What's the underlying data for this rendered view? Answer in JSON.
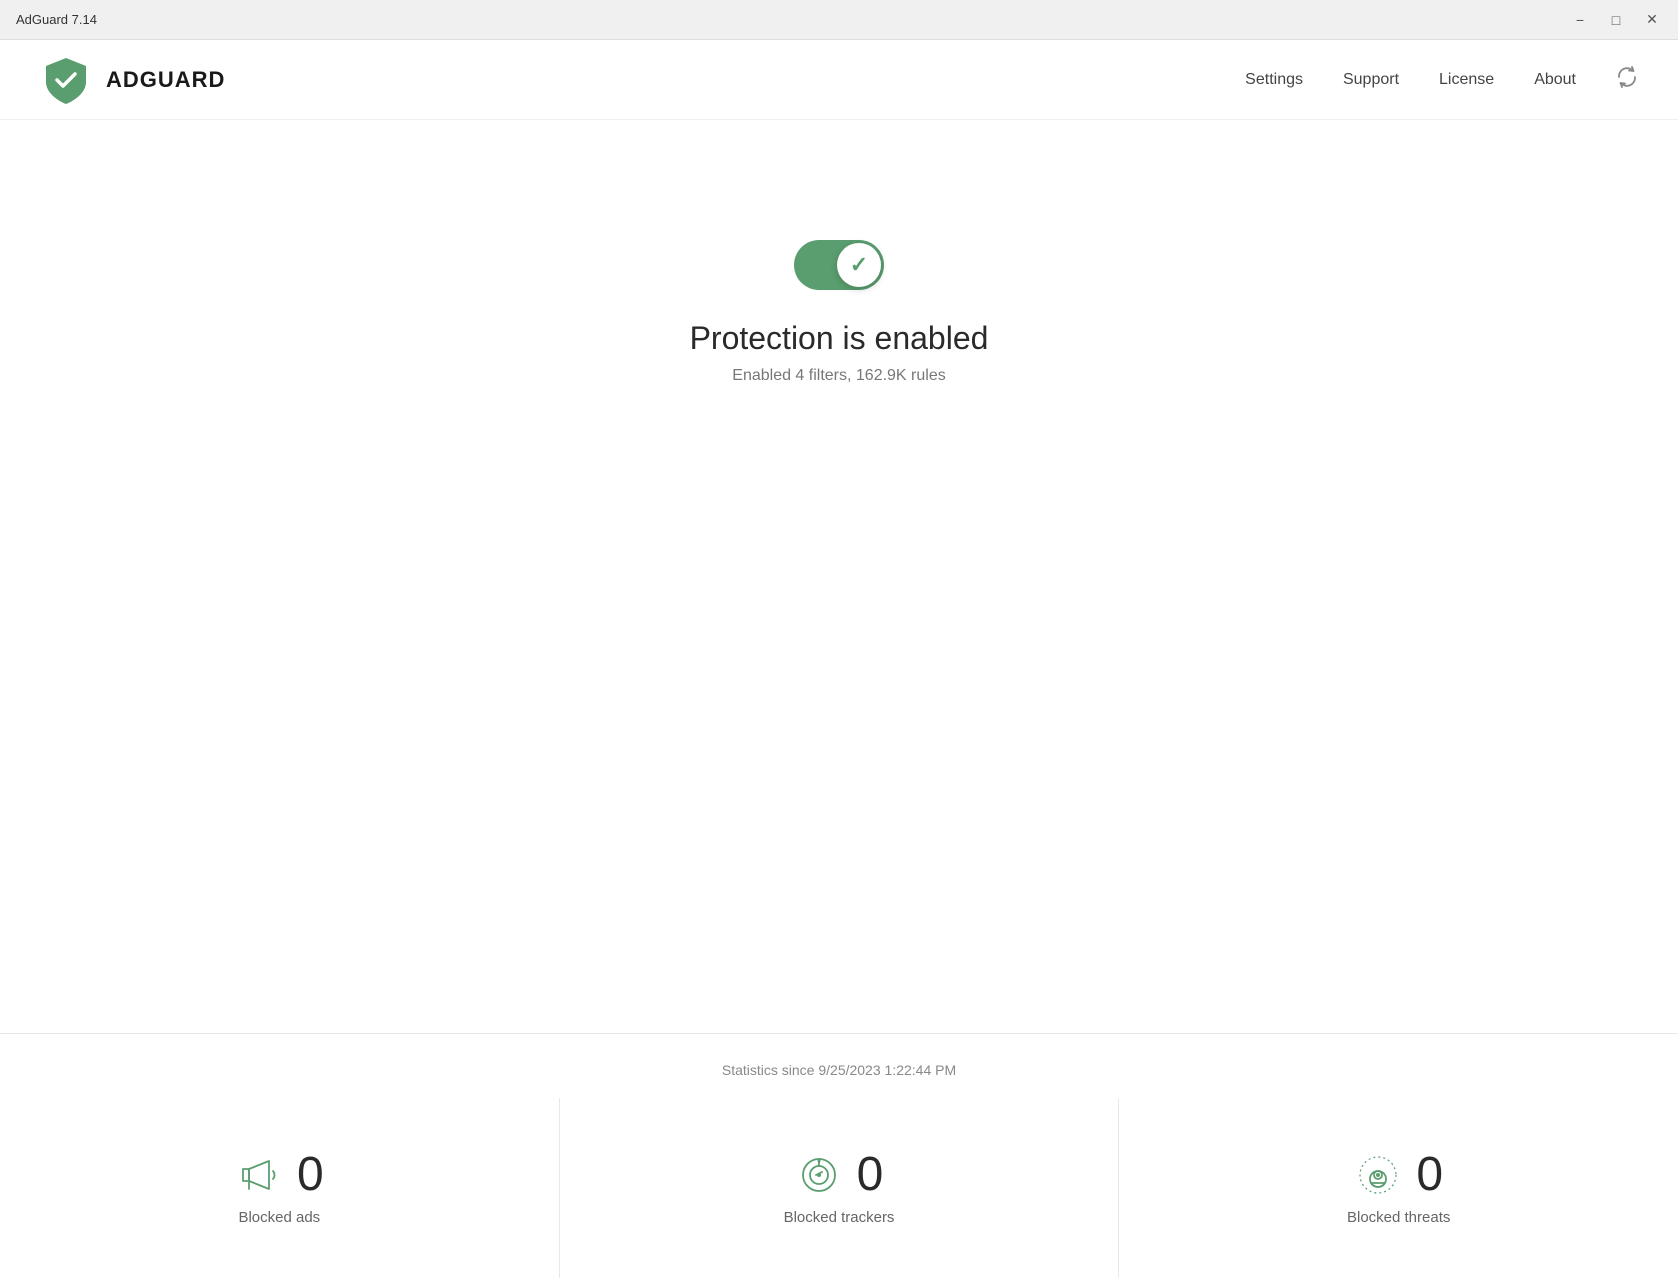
{
  "titlebar": {
    "title": "AdGuard 7.14",
    "minimize_label": "−",
    "maximize_label": "□",
    "close_label": "✕"
  },
  "header": {
    "logo_text": "ADGUARD",
    "nav": {
      "settings": "Settings",
      "support": "Support",
      "license": "License",
      "about": "About"
    }
  },
  "main": {
    "protection_status": "Protection is enabled",
    "filter_info": "Enabled 4 filters, 162.9K rules"
  },
  "stats": {
    "since_label": "Statistics since 9/25/2023 1:22:44 PM",
    "blocked_ads_label": "Blocked ads",
    "blocked_ads_count": "0",
    "blocked_trackers_label": "Blocked trackers",
    "blocked_trackers_count": "0",
    "blocked_threats_label": "Blocked threats",
    "blocked_threats_count": "0"
  },
  "colors": {
    "green": "#5a9e6f",
    "dark_text": "#2a2a2a",
    "muted_text": "#777"
  }
}
